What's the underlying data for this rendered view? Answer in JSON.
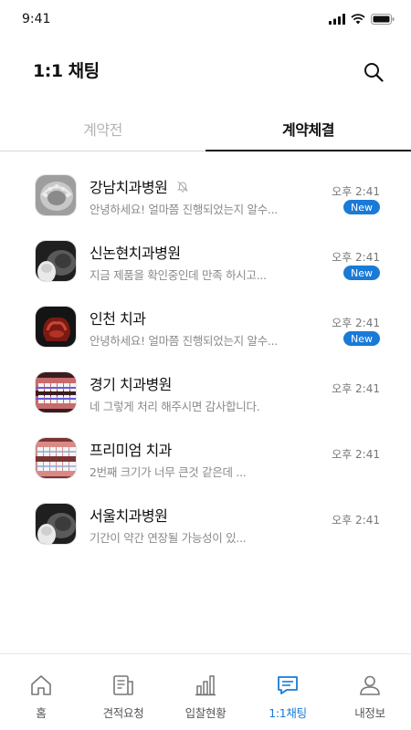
{
  "status_bar": {
    "time": "9:41"
  },
  "header": {
    "title": "1:1 채팅",
    "search_icon": "search-icon"
  },
  "tabs": [
    {
      "label": "계약전",
      "active": false
    },
    {
      "label": "계약체결",
      "active": true
    }
  ],
  "chats": [
    {
      "name": "강남치과병원",
      "preview": "안녕하세요! 얼마쯤 진행되었는지 알수...",
      "time": "오후 2:41",
      "badge": "New",
      "muted": true,
      "thumb": "dental-mold"
    },
    {
      "name": "신논현치과병원",
      "preview": "지금 제품을 확인중인데 만족 하시고...",
      "time": "오후 2:41",
      "badge": "New",
      "muted": false,
      "thumb": "dental-3d-scan"
    },
    {
      "name": "인천 치과",
      "preview": "안녕하세요! 얼마쯤 진행되었는지 알수...",
      "time": "오후 2:41",
      "badge": "New",
      "muted": false,
      "thumb": "tooth-crown"
    },
    {
      "name": "경기 치과병원",
      "preview": "네 그렇게 처리 해주시면 감사합니다.",
      "time": "오후 2:41",
      "badge": "",
      "muted": false,
      "thumb": "braces"
    },
    {
      "name": "프리미엄 치과",
      "preview": "2번째 크기가 너무 큰것 같은데 ...",
      "time": "오후 2:41",
      "badge": "",
      "muted": false,
      "thumb": "braces-open"
    },
    {
      "name": "서울치과병원",
      "preview": "기간이 약간 연장될 가능성이 있...",
      "time": "오후 2:41",
      "badge": "",
      "muted": false,
      "thumb": "dental-3d-scan"
    }
  ],
  "bottom_nav": [
    {
      "label": "홈",
      "icon": "home-icon",
      "active": false
    },
    {
      "label": "견적요청",
      "icon": "document-icon",
      "active": false
    },
    {
      "label": "입찰현황",
      "icon": "bar-chart-icon",
      "active": false
    },
    {
      "label": "1:1채팅",
      "icon": "chat-icon",
      "active": true
    },
    {
      "label": "내정보",
      "icon": "user-icon",
      "active": false
    }
  ],
  "colors": {
    "accent": "#1a7ad6",
    "inactive_tab": "#b4b4b4"
  }
}
